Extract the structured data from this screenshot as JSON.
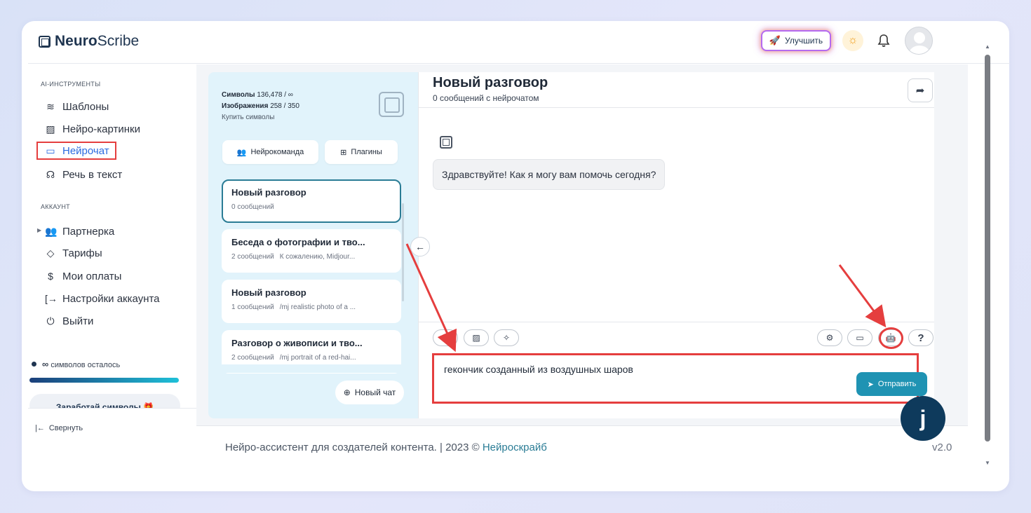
{
  "brand": {
    "bold": "Neuro",
    "rest": "Scribe"
  },
  "header": {
    "upgrade_label": "Улучшить",
    "rocket_icon": "rocket-icon",
    "sun_icon": "sun-icon",
    "bell_icon": "bell-icon"
  },
  "sidebar": {
    "section_tools": "AI-ИНСТРУМЕНТЫ",
    "tools": [
      {
        "label": "Шаблоны",
        "icon": "layers-icon"
      },
      {
        "label": "Нейро-картинки",
        "icon": "image-icon"
      },
      {
        "label": "Нейрочат",
        "icon": "chat-icon"
      },
      {
        "label": "Речь в текст",
        "icon": "headphones-icon"
      }
    ],
    "section_account": "АККАУНТ",
    "account": [
      {
        "label": "Партнерка",
        "icon": "users-icon"
      },
      {
        "label": "Тарифы",
        "icon": "tag-icon"
      },
      {
        "label": "Мои оплаты",
        "icon": "dollar-icon"
      },
      {
        "label": "Настройки аккаунта",
        "icon": "login-icon"
      },
      {
        "label": "Выйти",
        "icon": "power-icon"
      }
    ],
    "symbols_infinity": "∞",
    "symbols_left": "символов осталось",
    "symbols_progress": 1.0,
    "earn_label": "Заработай символы 🎁",
    "collapse_label": "Свернуть"
  },
  "chat_list": {
    "symbols_label": "Символы",
    "symbols_value": "136,478 / ∞",
    "images_label": "Изображения",
    "images_value": "258 / 350",
    "buy_label": "Купить символы",
    "team_btn": "Нейрокоманда",
    "plugins_btn": "Плагины",
    "items": [
      {
        "title": "Новый разговор",
        "count": "0 сообщений",
        "preview": ""
      },
      {
        "title": "Беседа о фотографии и тво...",
        "count": "2 сообщений",
        "preview": "К сожалению, Midjour..."
      },
      {
        "title": "Новый разговор",
        "count": "1 сообщений",
        "preview": "/mj realistic photo of a ..."
      },
      {
        "title": "Разговор о живописи и тво...",
        "count": "2 сообщений",
        "preview": "/mj portrait of a red-hai..."
      }
    ],
    "new_chat_label": "Новый чат"
  },
  "chat": {
    "title": "Новый разговор",
    "subtitle": "0 сообщений с нейрочатом",
    "greeting": "Здравствуйте! Как я могу вам помочь сегодня?",
    "input_value": "гекончик созданный из воздушных шаров",
    "send_label": "Отправить",
    "help_label": "?"
  },
  "footer": {
    "text": "Нейро-ассистент для создателей контента.  | 2023 © ",
    "link": "Нейроскрайб",
    "version": "v2.0"
  },
  "fab_label": "j",
  "colors": {
    "accent": "#1f93b3",
    "highlight": "#e53e3e",
    "panel": "#e1f3fb",
    "active_nav": "#2b6be0"
  }
}
